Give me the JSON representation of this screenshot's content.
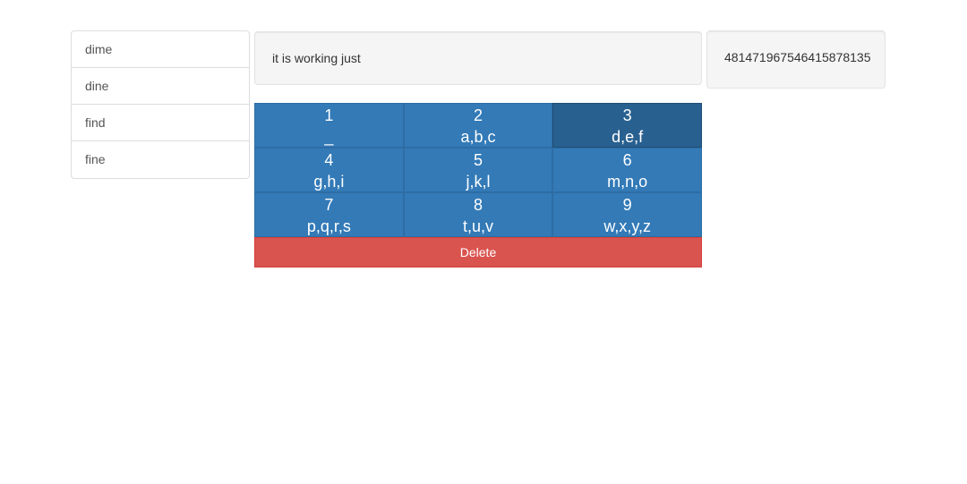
{
  "suggestions": {
    "items": [
      {
        "label": "dime"
      },
      {
        "label": "dine"
      },
      {
        "label": "find"
      },
      {
        "label": "fine"
      }
    ]
  },
  "output": {
    "text": "it is working just",
    "digits": "481471967546415878135"
  },
  "keypad": {
    "active_key": "3",
    "rows": [
      [
        {
          "digit": "1",
          "letters": "_"
        },
        {
          "digit": "2",
          "letters": "a,b,c"
        },
        {
          "digit": "3",
          "letters": "d,e,f"
        }
      ],
      [
        {
          "digit": "4",
          "letters": "g,h,i"
        },
        {
          "digit": "5",
          "letters": "j,k,l"
        },
        {
          "digit": "6",
          "letters": "m,n,o"
        }
      ],
      [
        {
          "digit": "7",
          "letters": "p,q,r,s"
        },
        {
          "digit": "8",
          "letters": "t,u,v"
        },
        {
          "digit": "9",
          "letters": "w,x,y,z"
        }
      ]
    ],
    "delete_label": "Delete"
  },
  "colors": {
    "key_primary": "#337ab7",
    "key_active": "#286090",
    "delete": "#d9534f",
    "panel_bg": "#f5f5f5"
  }
}
